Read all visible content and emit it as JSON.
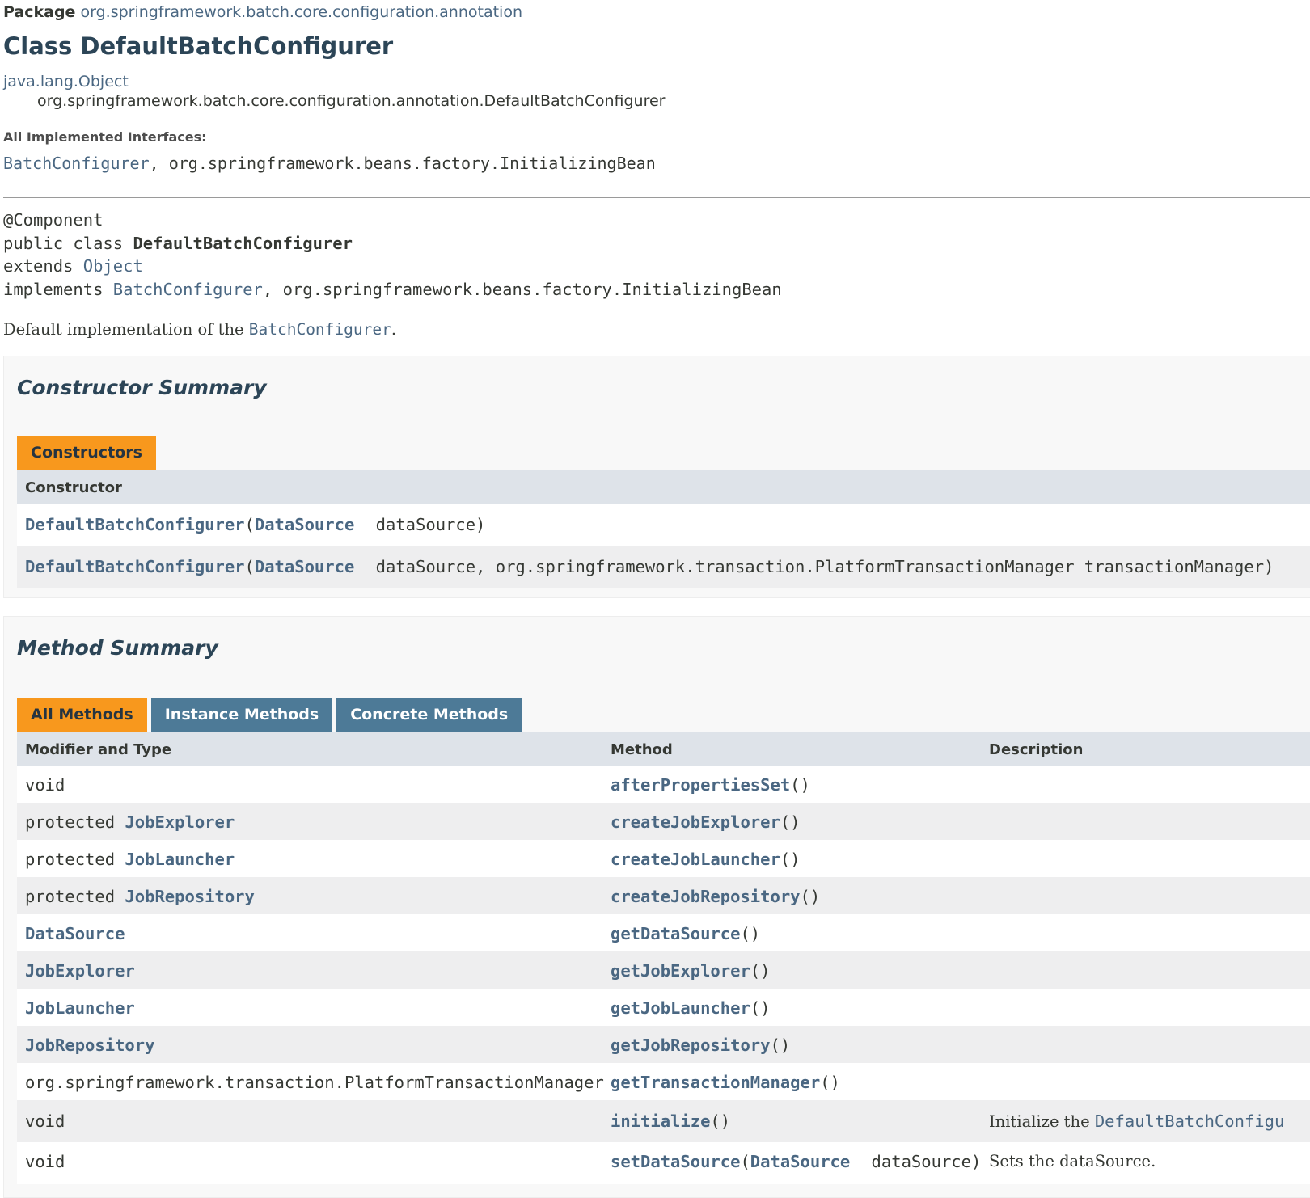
{
  "package": {
    "label": "Package",
    "name": "org.springframework.batch.core.configuration.annotation"
  },
  "class_title": "Class DefaultBatchConfigurer",
  "inheritance": {
    "root": "java.lang.Object",
    "self": "org.springframework.batch.core.configuration.annotation.DefaultBatchConfigurer"
  },
  "interfaces": {
    "heading": "All Implemented Interfaces:",
    "link": "BatchConfigurer",
    "rest": ", org.springframework.beans.factory.InitializingBean"
  },
  "signature": {
    "annotation": "@Component",
    "decl_prefix": "public class ",
    "class_name": "DefaultBatchConfigurer",
    "extends_kw": "extends ",
    "extends_link": "Object",
    "implements_kw": "implements ",
    "implements_link": "BatchConfigurer",
    "implements_rest": ", org.springframework.beans.factory.InitializingBean"
  },
  "description": {
    "prefix": "Default implementation of the ",
    "link": "BatchConfigurer",
    "suffix": "."
  },
  "constructor_summary": {
    "heading": "Constructor Summary",
    "tab": "Constructors",
    "column": "Constructor",
    "rows": [
      {
        "name": "DefaultBatchConfigurer",
        "open": "(",
        "type": "DataSource",
        "params": " dataSource)"
      },
      {
        "name": "DefaultBatchConfigurer",
        "open": "(",
        "type": "DataSource",
        "params": " dataSource, org.springframework.transaction.PlatformTransactionManager transactionManager)"
      }
    ]
  },
  "method_summary": {
    "heading": "Method Summary",
    "tabs": [
      "All Methods",
      "Instance Methods",
      "Concrete Methods"
    ],
    "columns": [
      "Modifier and Type",
      "Method",
      "Description"
    ],
    "rows": [
      {
        "mod": "void",
        "type_link": "",
        "method": "afterPropertiesSet",
        "args": "()",
        "desc_text": "",
        "desc_link": ""
      },
      {
        "mod": "protected ",
        "type_link": "JobExplorer",
        "method": "createJobExplorer",
        "args": "()",
        "desc_text": "",
        "desc_link": ""
      },
      {
        "mod": "protected ",
        "type_link": "JobLauncher",
        "method": "createJobLauncher",
        "args": "()",
        "desc_text": "",
        "desc_link": ""
      },
      {
        "mod": "protected ",
        "type_link": "JobRepository",
        "method": "createJobRepository",
        "args": "()",
        "desc_text": "",
        "desc_link": ""
      },
      {
        "mod": "",
        "type_link": "DataSource",
        "method": "getDataSource",
        "args": "()",
        "desc_text": "",
        "desc_link": ""
      },
      {
        "mod": "",
        "type_link": "JobExplorer",
        "method": "getJobExplorer",
        "args": "()",
        "desc_text": "",
        "desc_link": ""
      },
      {
        "mod": "",
        "type_link": "JobLauncher",
        "method": "getJobLauncher",
        "args": "()",
        "desc_text": "",
        "desc_link": ""
      },
      {
        "mod": "",
        "type_link": "JobRepository",
        "method": "getJobRepository",
        "args": "()",
        "desc_text": "",
        "desc_link": ""
      },
      {
        "mod": "org.springframework.transaction.PlatformTransactionManager",
        "type_link": "",
        "method": "getTransactionManager",
        "args": "()",
        "desc_text": "",
        "desc_link": ""
      },
      {
        "mod": "void",
        "type_link": "",
        "method": "initialize",
        "args": "()",
        "desc_text": "Initialize the ",
        "desc_link": "DefaultBatchConfigu"
      },
      {
        "mod": "void",
        "type_link": "",
        "method": "setDataSource",
        "args": "(",
        "arg_type": "DataSource",
        "arg_rest": " dataSource)",
        "desc_text": "Sets the dataSource.",
        "desc_link": ""
      }
    ]
  }
}
